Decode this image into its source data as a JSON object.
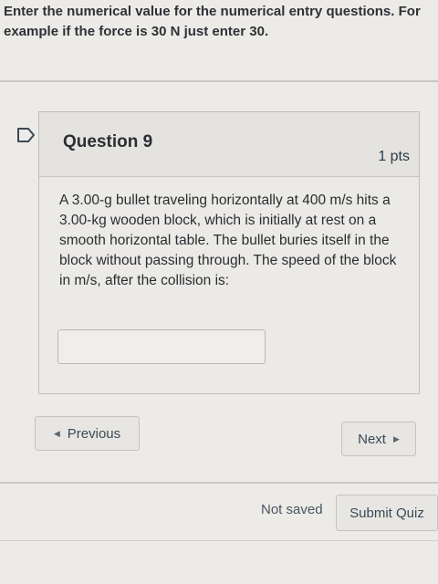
{
  "instructions": "Enter the numerical value for the numerical entry questions. For example if the force is 30 N just enter 30.",
  "question": {
    "title": "Question 9",
    "points": "1 pts",
    "text": "A 3.00-g bullet traveling horizontally at 400 m/s hits a 3.00-kg wooden block, which is initially at rest on a smooth horizontal table. The bullet buries itself in the block without passing through. The speed of the block in m/s, after the collision is:",
    "answer_value": ""
  },
  "navigation": {
    "previous_label": "Previous",
    "next_label": "Next"
  },
  "footer": {
    "status": "Not saved",
    "submit_label": "Submit Quiz"
  },
  "icons": {
    "flag": "flag-question-icon",
    "previous": "triangle-left-icon",
    "next": "triangle-right-icon"
  }
}
